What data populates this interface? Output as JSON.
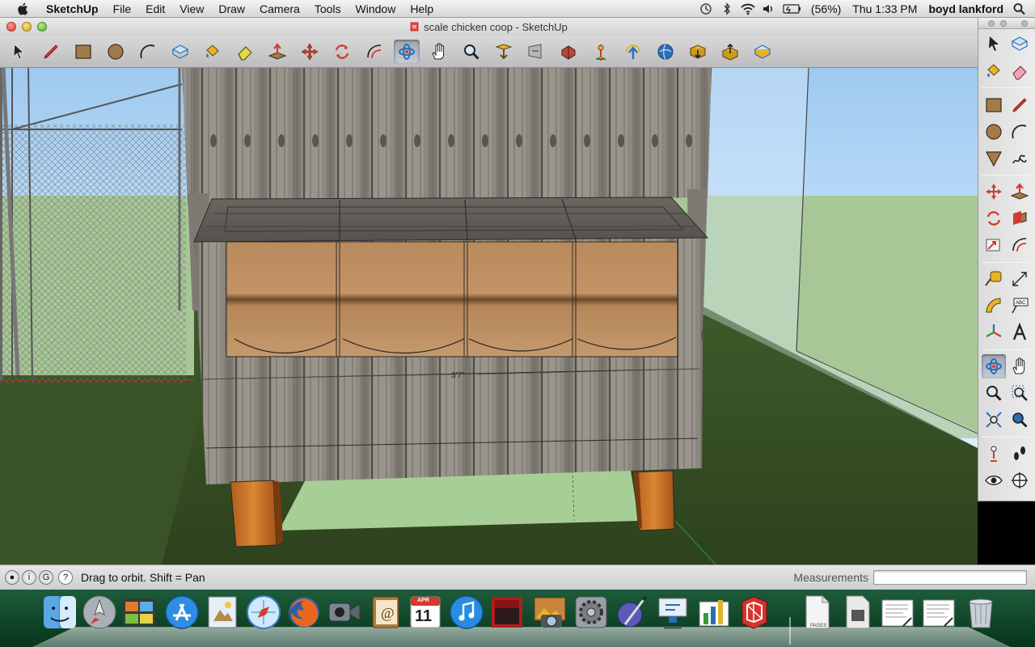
{
  "menubar": {
    "items": [
      "SketchUp",
      "File",
      "Edit",
      "View",
      "Draw",
      "Camera",
      "Tools",
      "Window",
      "Help"
    ],
    "battery": "(56%)",
    "clock": "Thu 1:33 PM",
    "user": "boyd lankford"
  },
  "window": {
    "title": "scale chicken coop - SketchUp"
  },
  "toolbar": {
    "tools": [
      "select-tool-icon",
      "pencil-line-icon",
      "rectangle-icon",
      "circle-icon",
      "arc-icon",
      "make-component-icon",
      "paint-bucket-icon",
      "eraser-icon",
      "push-pull-icon",
      "move-icon",
      "rotate-icon",
      "offset-icon",
      "orbit-icon",
      "pan-icon",
      "zoom-icon",
      "zoom-extents-icon",
      "previous-view-icon",
      "next-view-icon",
      "position-camera-icon",
      "look-around-icon",
      "walk-icon",
      "get-models-icon",
      "share-model-icon",
      "get-components-icon",
      "share-component-icon"
    ],
    "active": "orbit-icon"
  },
  "viewport": {
    "dimension_label": "3'7\""
  },
  "palette": {
    "active": "palette-orbit-icon"
  },
  "statusbar": {
    "hint": "Drag to orbit.  Shift = Pan",
    "measurements_label": "Measurements",
    "measurements_value": ""
  },
  "dock": {
    "apps": [
      "finder-icon",
      "launchpad-icon",
      "dashboard-icon",
      "app-store-icon",
      "preview-icon",
      "safari-icon",
      "firefox-icon",
      "facetime-icon",
      "address-book-icon",
      "ical-icon",
      "itunes-icon",
      "photo-booth-icon",
      "iphoto-icon",
      "system-preferences-icon",
      "script-editor-icon",
      "keynote-icon",
      "numbers-icon",
      "sketchup-icon",
      "pages-doc-icon",
      "document-icon",
      "text-doc-icon",
      "text-doc-icon-2",
      "trash-icon"
    ],
    "ical_month": "APR",
    "ical_day": "11",
    "pages_label": "PAGES"
  }
}
